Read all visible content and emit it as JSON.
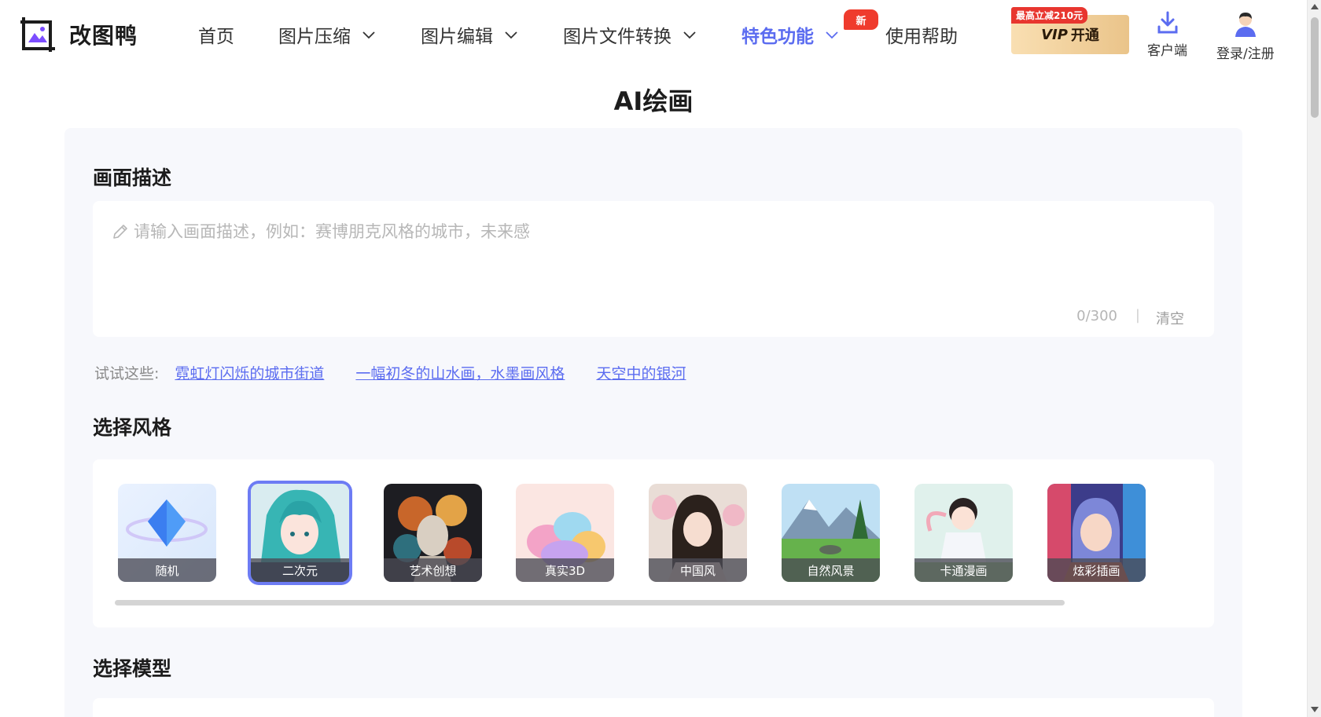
{
  "brand": {
    "name": "改图鸭"
  },
  "nav": [
    {
      "label": "首页",
      "has_dropdown": false
    },
    {
      "label": "图片压缩",
      "has_dropdown": true
    },
    {
      "label": "图片编辑",
      "has_dropdown": true
    },
    {
      "label": "图片文件转换",
      "has_dropdown": true
    },
    {
      "label": "特色功能",
      "has_dropdown": true,
      "active": true,
      "badge": "新"
    },
    {
      "label": "使用帮助",
      "has_dropdown": false
    }
  ],
  "vip": {
    "promo": "最高立减210元",
    "v_label": "VIP",
    "open_label": "开通"
  },
  "header_actions": {
    "client": "客户端",
    "login": "登录/注册"
  },
  "page_title": "AI绘画",
  "description": {
    "title": "画面描述",
    "value": "",
    "placeholder": "请输入画面描述，例如：赛博朋克风格的城市，未来感",
    "counter": "0/300",
    "separator": "|",
    "clear_label": "清空"
  },
  "suggestions": {
    "label": "试试这些:",
    "items": [
      "霓虹灯闪烁的城市街道",
      "一幅初冬的山水画，水墨画风格",
      "天空中的银河"
    ]
  },
  "style_section": {
    "title": "选择风格",
    "selected": "二次元",
    "items": [
      "随机",
      "二次元",
      "艺术创想",
      "真实3D",
      "中国风",
      "自然风景",
      "卡通漫画",
      "炫彩插画"
    ]
  },
  "model_section": {
    "title": "选择模型"
  },
  "colors": {
    "accent": "#5b6cf0",
    "selected_border": "#6d7cf4",
    "badge_red": "#ef3b2d",
    "vip_gold": "#eac48a"
  }
}
